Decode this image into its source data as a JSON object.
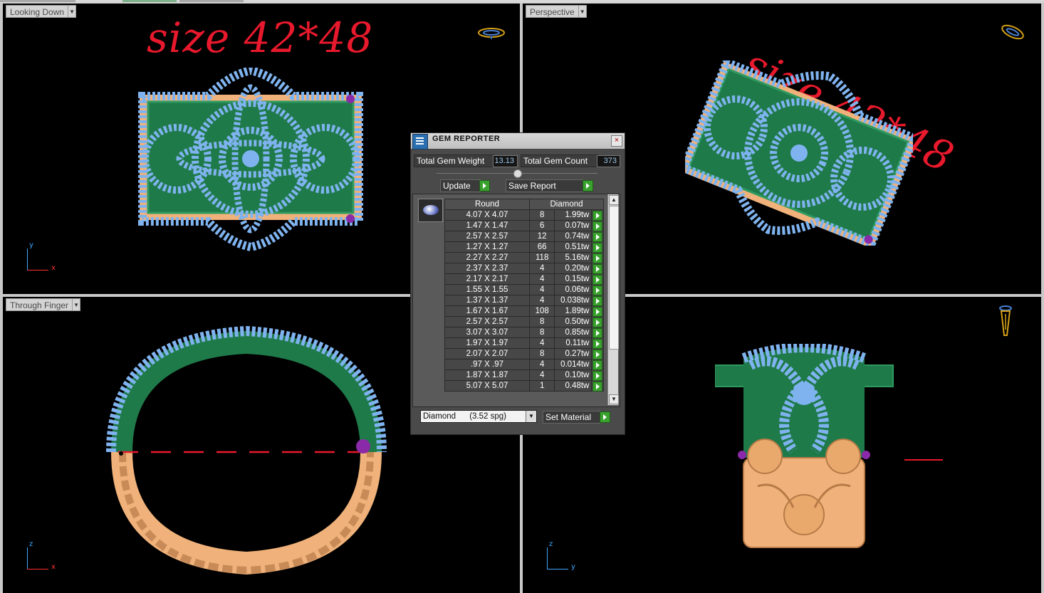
{
  "viewports": {
    "top_left": {
      "label": "Looking Down",
      "size_text": "size 42*48",
      "axis_v": "y",
      "axis_h": "x"
    },
    "top_right": {
      "label": "Perspective",
      "size_text": "size 42*48"
    },
    "bottom_left": {
      "label": "Through Finger",
      "axis_v": "z",
      "axis_h": "x"
    },
    "bottom_right": {
      "axis_v": "z",
      "axis_h": "y"
    }
  },
  "gem_reporter": {
    "title": "GEM REPORTER",
    "close_label": "×",
    "total_weight_label": "Total Gem Weight",
    "total_weight_value": "13.13",
    "total_count_label": "Total Gem Count",
    "total_count_value": "373",
    "update_label": "Update",
    "save_report_label": "Save Report",
    "columns": [
      "Round",
      "Diamond"
    ],
    "rows": [
      {
        "size": "4.07 X 4.07",
        "count": "8",
        "weight": "1.99tw"
      },
      {
        "size": "1.47 X 1.47",
        "count": "6",
        "weight": "0.07tw"
      },
      {
        "size": "2.57 X 2.57",
        "count": "12",
        "weight": "0.74tw"
      },
      {
        "size": "1.27 X 1.27",
        "count": "66",
        "weight": "0.51tw"
      },
      {
        "size": "2.27 X 2.27",
        "count": "118",
        "weight": "5.16tw"
      },
      {
        "size": "2.37 X 2.37",
        "count": "4",
        "weight": "0.20tw"
      },
      {
        "size": "2.17 X 2.17",
        "count": "4",
        "weight": "0.15tw"
      },
      {
        "size": "1.55 X 1.55",
        "count": "4",
        "weight": "0.06tw"
      },
      {
        "size": "1.37 X 1.37",
        "count": "4",
        "weight": "0.038tw"
      },
      {
        "size": "1.67 X 1.67",
        "count": "108",
        "weight": "1.89tw"
      },
      {
        "size": "2.57 X 2.57",
        "count": "8",
        "weight": "0.50tw"
      },
      {
        "size": "3.07 X 3.07",
        "count": "8",
        "weight": "0.85tw"
      },
      {
        "size": "1.97 X 1.97",
        "count": "4",
        "weight": "0.11tw"
      },
      {
        "size": "2.07 X 2.07",
        "count": "8",
        "weight": "0.27tw"
      },
      {
        "size": ".97 X .97",
        "count": "4",
        "weight": "0.014tw"
      },
      {
        "size": "1.87 X 1.87",
        "count": "4",
        "weight": "0.10tw"
      },
      {
        "size": "5.07 X 5.07",
        "count": "1",
        "weight": "0.48tw"
      }
    ],
    "material_value": "Diamond      (3.52 spg)",
    "set_material_label": "Set Material"
  },
  "icons": [
    "ring-orientation-icon",
    "gem-thumbnail-icon",
    "gem-reporter-app-icon"
  ]
}
